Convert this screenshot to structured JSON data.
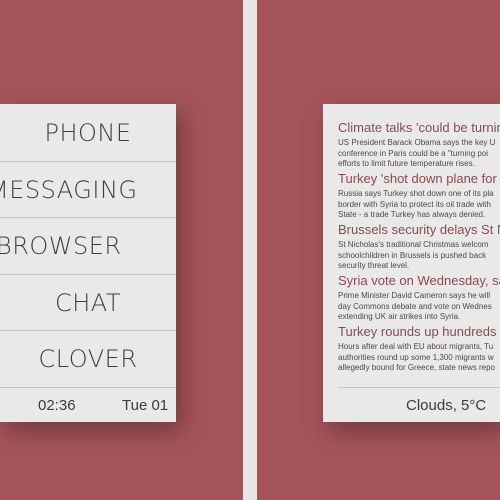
{
  "colors": {
    "background": "#a45459",
    "panel": "#e9e9e9",
    "headline": "#8b4a50"
  },
  "launcher": {
    "apps": [
      "PHONE",
      "MESSAGING",
      "BROWSER",
      "CHAT",
      "CLOVER"
    ],
    "time": "02:36",
    "date": "Tue 01"
  },
  "news": {
    "items": [
      {
        "headline": "Climate talks 'could be turning p",
        "lines": [
          "US President Barack Obama says the key U",
          "conference in Paris could be a \"turning poi",
          "efforts to limit future temperature rises."
        ]
      },
      {
        "headline": "Turkey 'shot down plane for IS o",
        "lines": [
          "Russia says Turkey shot down one of its pla",
          "border with Syria to protect its oil trade with",
          "State - a trade Turkey has always denied."
        ]
      },
      {
        "headline": "Brussels security delays St Nich",
        "lines": [
          "St Nicholas's traditional Christmas welcom",
          "schoolchildren in Brussels is pushed back",
          "security threat level."
        ]
      },
      {
        "headline": "Syria vote on Wednesday, says P",
        "lines": [
          "Prime Minister David Cameron says he will",
          "day Commons debate and vote on Wednes",
          "extending UK air strikes into Syria."
        ]
      },
      {
        "headline": "Turkey rounds up hundreds of m",
        "lines": [
          "Hours after deal with EU about migrants, Tu",
          "authorities round up some 1,300 migrants w",
          "allegedly bound for Greece, state news repo"
        ]
      }
    ],
    "weather": "Clouds, 5°C"
  }
}
